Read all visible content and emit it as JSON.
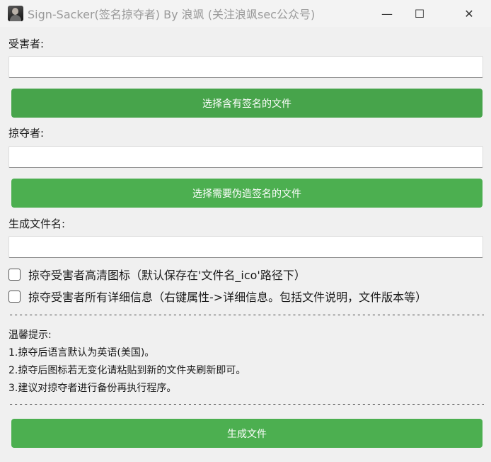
{
  "window": {
    "title": "Sign-Sacker(签名掠夺者) By 浪飒 (关注浪飒sec公众号)",
    "minimize_glyph": "—",
    "maximize_glyph": "☐",
    "close_glyph": "✕"
  },
  "form": {
    "victim_label": "受害者:",
    "victim_value": "",
    "select_signed_button": "选择含有签名的文件",
    "plunderer_label": "掠夺者:",
    "plunderer_value": "",
    "select_forge_button": "选择需要伪造签名的文件",
    "output_label": "生成文件名:",
    "output_value": "",
    "option_icon_label": "掠夺受害者高清图标（默认保存在'文件名_ico'路径下）",
    "option_icon_checked": false,
    "option_info_label": "掠夺受害者所有详细信息（右键属性->详细信息。包括文件说明，文件版本等）",
    "option_info_checked": false,
    "generate_button": "生成文件"
  },
  "divider_text": "--------------------------------------------------------------------------------------------------------------------",
  "tips": {
    "heading": "温馨提示:",
    "lines": [
      "1.掠夺后语言默认为英语(美国)。",
      "2.掠夺后图标若无变化请粘贴到新的文件夹刷新即可。",
      "3.建议对掠夺者进行备份再执行程序。"
    ]
  },
  "colors": {
    "primary_button": "#4caf50",
    "primary_button_dark": "#47a44b",
    "background": "#f0f0f0"
  },
  "icons": {
    "app": "avatar-icon",
    "minimize": "minimize-icon",
    "maximize": "maximize-icon",
    "close": "close-icon"
  }
}
